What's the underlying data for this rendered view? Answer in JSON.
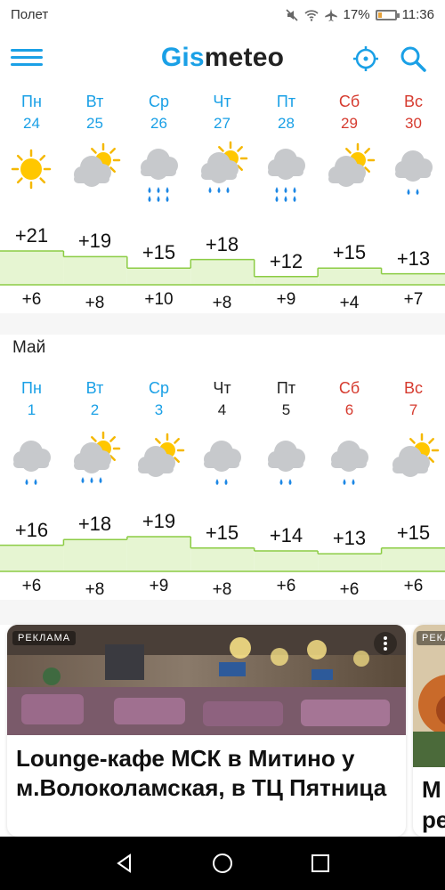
{
  "status_bar": {
    "carrier": "Полет",
    "battery": "17%",
    "time": "11:36"
  },
  "app": {
    "logo_part1": "Gis",
    "logo_part2": "meteo"
  },
  "colors": {
    "accent": "#1aa0e6",
    "weekend": "#d63b2f",
    "band_fill": "#e6f5d2",
    "band_line": "#8ccc44"
  },
  "week1": {
    "days": [
      {
        "name": "Пн",
        "num": "24",
        "max": "+21",
        "min": "+6",
        "icon": "sun-icon",
        "weekend": false
      },
      {
        "name": "Вт",
        "num": "25",
        "max": "+19",
        "min": "+8",
        "icon": "partly-cloudy-icon",
        "weekend": false
      },
      {
        "name": "Ср",
        "num": "26",
        "max": "+15",
        "min": "+10",
        "icon": "rain-icon",
        "weekend": false
      },
      {
        "name": "Чт",
        "num": "27",
        "max": "+18",
        "min": "+8",
        "icon": "sun-rain-icon",
        "weekend": false
      },
      {
        "name": "Пт",
        "num": "28",
        "max": "+12",
        "min": "+9",
        "icon": "rain-icon",
        "weekend": false
      },
      {
        "name": "Сб",
        "num": "29",
        "max": "+15",
        "min": "+4",
        "icon": "partly-cloudy-icon",
        "weekend": true
      },
      {
        "name": "Вс",
        "num": "30",
        "max": "+13",
        "min": "+7",
        "icon": "light-rain-icon",
        "weekend": true
      }
    ]
  },
  "month_label": "Май",
  "week2": {
    "days": [
      {
        "name": "Пн",
        "num": "1",
        "max": "+16",
        "min": "+6",
        "icon": "light-rain-icon",
        "weekend": false,
        "muted": false
      },
      {
        "name": "Вт",
        "num": "2",
        "max": "+18",
        "min": "+8",
        "icon": "sun-rain-icon",
        "weekend": false,
        "muted": false
      },
      {
        "name": "Ср",
        "num": "3",
        "max": "+19",
        "min": "+9",
        "icon": "partly-cloudy-icon",
        "weekend": false,
        "muted": false
      },
      {
        "name": "Чт",
        "num": "4",
        "max": "+15",
        "min": "+8",
        "icon": "light-rain-icon",
        "weekend": false,
        "muted": true
      },
      {
        "name": "Пт",
        "num": "5",
        "max": "+14",
        "min": "+6",
        "icon": "light-rain-icon",
        "weekend": false,
        "muted": true
      },
      {
        "name": "Сб",
        "num": "6",
        "max": "+13",
        "min": "+6",
        "icon": "light-rain-icon",
        "weekend": true,
        "muted": true
      },
      {
        "name": "Вс",
        "num": "7",
        "max": "+15",
        "min": "+6",
        "icon": "partly-cloudy-icon",
        "weekend": true,
        "muted": true
      }
    ]
  },
  "ads": [
    {
      "label": "РЕКЛАМА",
      "title": "Lounge-кафе МСК в Митино у м.Волоколамская, в ТЦ Пятница"
    },
    {
      "label": "РЕКЛ",
      "title": "М\nре"
    }
  ]
}
